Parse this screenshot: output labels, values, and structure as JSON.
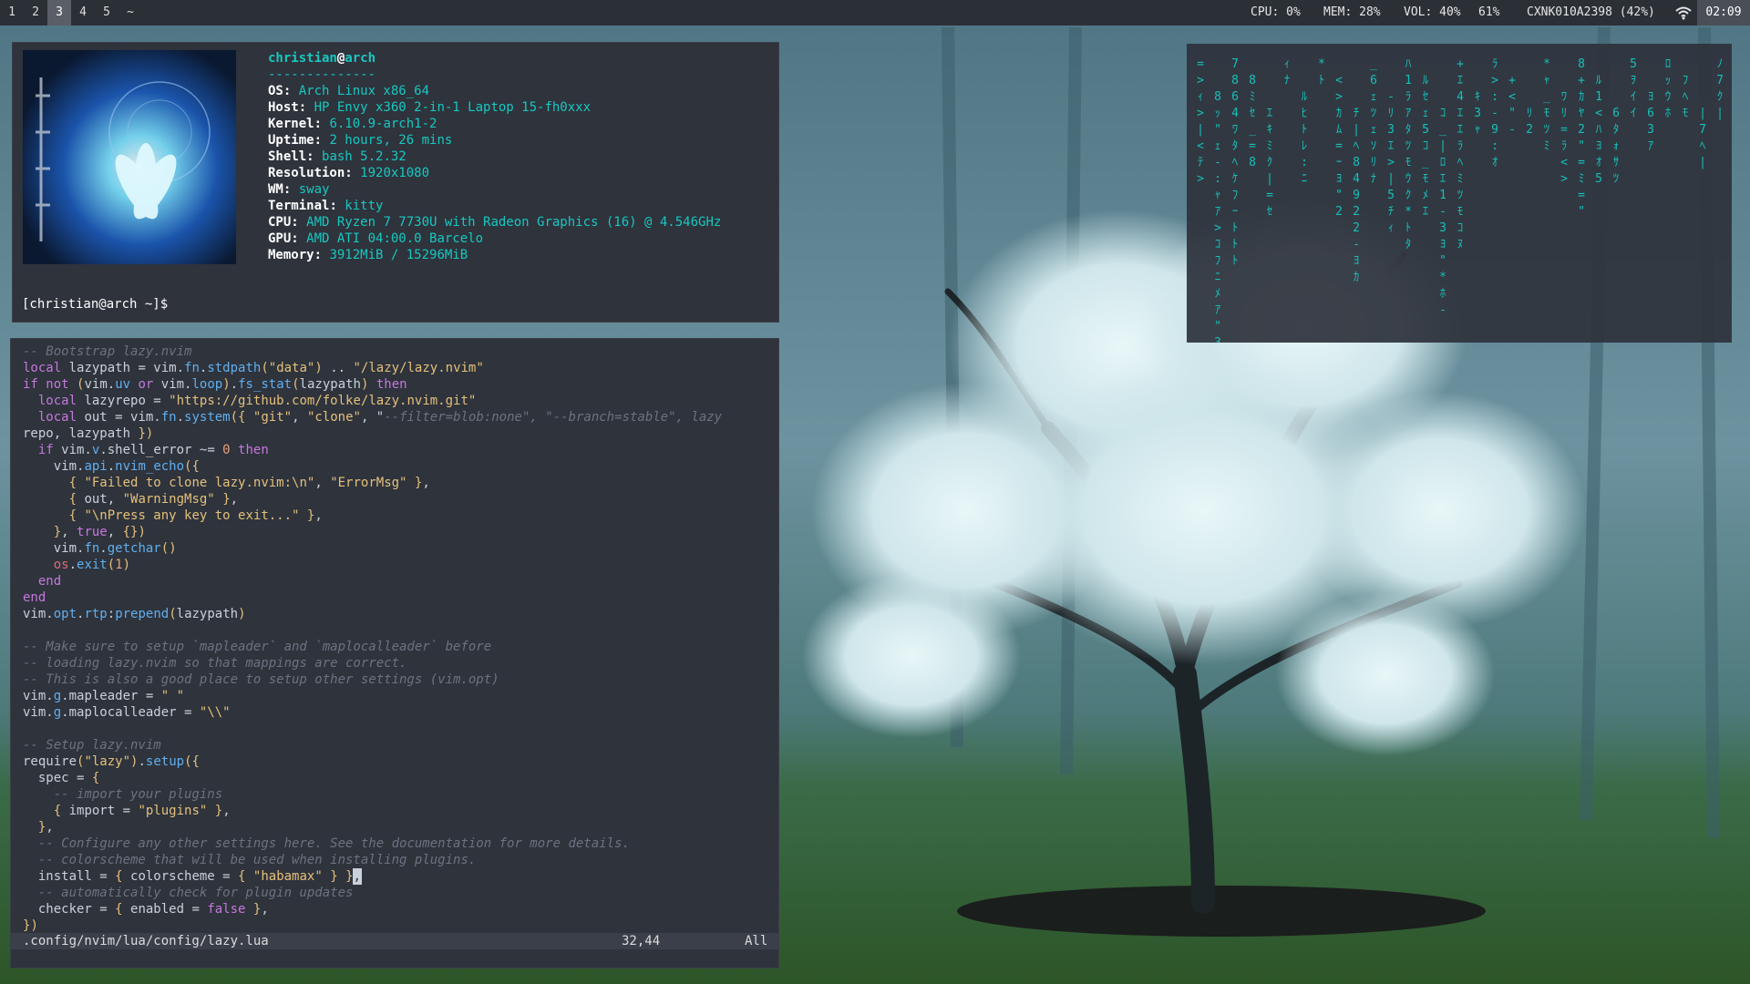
{
  "colors": {
    "bar_bg": "#2b2f36",
    "window_bg": "#2e333c",
    "accent": "#18c8c0",
    "keyword": "#c678dd",
    "string": "#e5c07b",
    "function": "#61afef",
    "comment": "#6b7380"
  },
  "topbar": {
    "workspaces": [
      "1",
      "2",
      "3",
      "4",
      "5",
      "~"
    ],
    "active_workspace": "3",
    "cpu": "CPU: 0%",
    "mem": "MEM: 28%",
    "vol": "VOL: 40%",
    "battery": "61%",
    "network": "CXNK010A2398 (42%)",
    "wifi_icon": "wifi-icon",
    "clock": "02:09"
  },
  "fetch": {
    "user": "christian",
    "at": "@",
    "host": "arch",
    "separator": "--------------",
    "rows": [
      {
        "key": "OS",
        "value": "Arch Linux x86_64"
      },
      {
        "key": "Host",
        "value": "HP Envy x360 2-in-1 Laptop 15-fh0xxx"
      },
      {
        "key": "Kernel",
        "value": "6.10.9-arch1-2"
      },
      {
        "key": "Uptime",
        "value": "2 hours, 26 mins"
      },
      {
        "key": "Shell",
        "value": "bash 5.2.32"
      },
      {
        "key": "Resolution",
        "value": "1920x1080"
      },
      {
        "key": "WM",
        "value": "sway"
      },
      {
        "key": "Terminal",
        "value": "kitty"
      },
      {
        "key": "CPU",
        "value": "AMD Ryzen 7 7730U with Radeon Graphics (16) @ 4.546GHz"
      },
      {
        "key": "GPU",
        "value": "AMD ATI 04:00.0 Barcelo"
      },
      {
        "key": "Memory",
        "value": "3912MiB / 15296MiB"
      }
    ],
    "prompt": "[christian@arch ~]$"
  },
  "editor": {
    "code_lines": [
      "-- Bootstrap lazy.nvim",
      "local lazypath = vim.fn.stdpath(\"data\") .. \"/lazy/lazy.nvim\"",
      "if not (vim.uv or vim.loop).fs_stat(lazypath) then",
      "  local lazyrepo = \"https://github.com/folke/lazy.nvim.git\"",
      "  local out = vim.fn.system({ \"git\", \"clone\", \"--filter=blob:none\", \"--branch=stable\", lazy",
      "repo, lazypath })",
      "  if vim.v.shell_error ~= 0 then",
      "    vim.api.nvim_echo({",
      "      { \"Failed to clone lazy.nvim:\\n\", \"ErrorMsg\" },",
      "      { out, \"WarningMsg\" },",
      "      { \"\\nPress any key to exit...\" },",
      "    }, true, {})",
      "    vim.fn.getchar()",
      "    os.exit(1)",
      "  end",
      "end",
      "vim.opt.rtp:prepend(lazypath)",
      "",
      "-- Make sure to setup `mapleader` and `maplocalleader` before",
      "-- loading lazy.nvim so that mappings are correct.",
      "-- This is also a good place to setup other settings (vim.opt)",
      "vim.g.mapleader = \" \"",
      "vim.g.maplocalleader = \"\\\\\"",
      "",
      "-- Setup lazy.nvim",
      "require(\"lazy\").setup({",
      "  spec = {",
      "    -- import your plugins",
      "    { import = \"plugins\" },",
      "  },",
      "  -- Configure any other settings here. See the documentation for more details.",
      "  -- colorscheme that will be used when installing plugins.",
      "  install = { colorscheme = { \"habamax\" } },",
      "  -- automatically check for plugin updates",
      "  checker = { enabled = false },",
      "})"
    ],
    "file_path": ".config/nvim/lua/config/lazy.lua",
    "cursor_pos": "32,44",
    "scroll": "All"
  },
  "matrix": {
    "columns": [
      "=>ｨ>|<ﾃ>",
      "8ｯ\"ｪ-:ｬｱ>ｺﾌﾆﾒｱ\"3",
      "7864ﾜﾀﾍｹﾌｰﾄﾄﾄ",
      "8ﾐｾ_=8",
      "ｴｷﾐｸ|=ｾ",
      "ｨﾅ",
      "ﾙﾋﾄﾚ:ﾆ",
      "*ﾄ",
      "<>ｶﾑ=ｰﾖ\"2",
      "ﾁ|ﾍ84922-ﾖｶ",
      "_6ｪﾂｪｿﾘﾅ",
      "-ﾘ3ｴ>|5ﾁｨ",
      "ﾊ1ﾗｱﾀﾂﾓｳｸ*ﾄﾀ",
      "ﾙｾｪ5ｺ_ﾓﾒｴ",
      "ｺ_|ﾛｴ1-3ﾖ\"*ﾎ-",
      "+ｴ4ｴｴﾗﾍﾐﾂﾓｺﾇ",
      "ｷ3ｬ",
      "ﾗ>:-9:ｵ",
      "+<\"-",
      "ﾘ2",
      "*ｬ_ﾓﾂﾐ",
      "ﾜﾘ=ﾗ<>",
      "8+ｶﾔ2\"=ﾐ=\"",
      "ﾙ1<ﾊﾖｵ5",
      "6ﾀｫｻﾂ",
      "5ｦｲｲ",
      "ﾖ63ｱ",
      "ﾛｯｳﾎ",
      "ﾌﾍﾓ",
      "|7ﾍ|",
      "ﾉ7ｸ|"
    ]
  }
}
